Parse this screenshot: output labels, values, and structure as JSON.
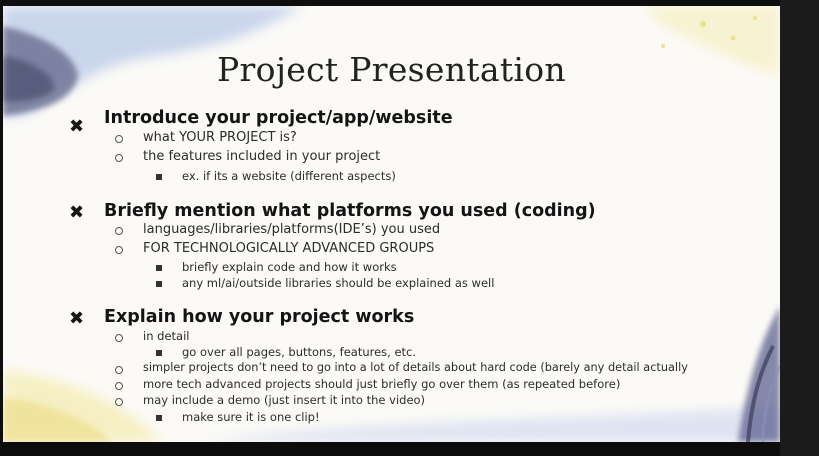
{
  "slide": {
    "title": "Project Presentation",
    "sections": [
      {
        "heading": "Introduce your project/app/website",
        "items": [
          {
            "text": "what YOUR PROJECT is?"
          },
          {
            "text": "the features included in your project",
            "sub": [
              "ex. if its a website (different aspects)"
            ]
          }
        ]
      },
      {
        "heading": "Briefly mention what platforms you used (coding)",
        "items": [
          {
            "text": "languages/libraries/platforms(IDE’s) you used"
          },
          {
            "text": "FOR TECHNOLOGICALLY ADVANCED GROUPS",
            "sub": [
              "briefly explain code and how it works",
              "any ml/ai/outside libraries should be explained as well"
            ]
          }
        ]
      },
      {
        "heading": "Explain how your project works",
        "items": [
          {
            "text": "in detail",
            "sub": [
              "go over all pages, buttons, features, etc."
            ]
          },
          {
            "text": "simpler projects don’t need to go into a lot of details about hard code (barely any detail actually"
          },
          {
            "text": "more tech advanced projects should just briefly go over them (as repeated before)"
          },
          {
            "text": "may include a demo (just insert it into the video)",
            "sub": [
              "make sure it is one clip!"
            ]
          }
        ]
      }
    ]
  },
  "colors": {
    "slide_bg": "#fbfaf7",
    "text": "#222222",
    "accent_blue": "#9fb4d9",
    "accent_yellow": "#f2e69a",
    "accent_purple": "#6b6f9c"
  },
  "icons": {
    "section_marker": "x-mark-icon",
    "level1_bullet": "hollow-circle-bullet",
    "level2_bullet": "filled-square-bullet"
  }
}
